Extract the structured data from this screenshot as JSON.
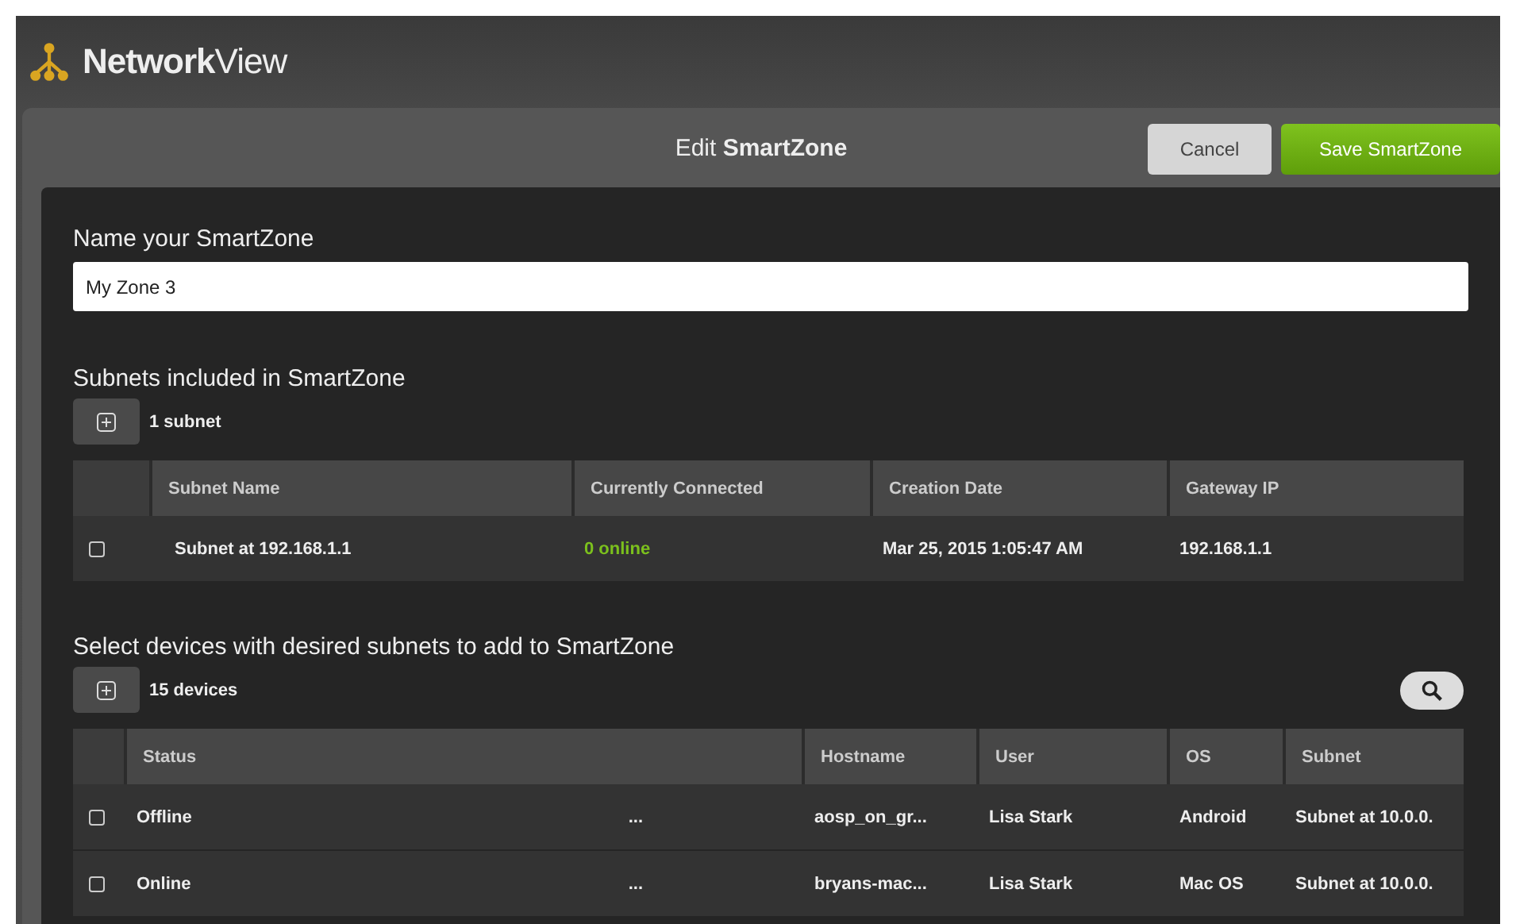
{
  "app": {
    "title": "**Network**View"
  },
  "dialog": {
    "title": "Edit **SmartZone**",
    "buttons": [
      {
        "kind": "secondary",
        "label": "Cancel"
      },
      {
        "kind": "primary",
        "label": "Save SmartZone"
      }
    ]
  },
  "name_field": {
    "label": "Name your SmartZone",
    "value": "My Zone 3"
  },
  "subnets": {
    "heading": "Subnets included in SmartZone",
    "count": "1 subnet",
    "columns": [
      "Subnet Name",
      "Currently Connected",
      "Creation Date",
      "Gateway IP"
    ],
    "rows": [
      {
        "checked": false,
        "name": "Subnet at 192.168.1.1",
        "connected": "0 online",
        "created": "Mar 25, 2015 1:05:47 AM",
        "gateway": "192.168.1.1"
      }
    ]
  },
  "devices": {
    "heading": "Select devices with desired subnets to add to SmartZone",
    "count": "15 devices",
    "columns": [
      "Status",
      "Hostname",
      "User",
      "OS",
      "Subnet"
    ],
    "rows": [
      {
        "checked": false,
        "status": "Offline",
        "column_2": "...",
        "hostname": "aosp_on_gr...",
        "user": "Lisa Stark",
        "os": "Android",
        "subnet": "Subnet at 10.0.0."
      },
      {
        "checked": false,
        "status": "Online",
        "column_2": "...",
        "hostname": "bryans-mac...",
        "user": "Lisa Stark",
        "os": "Mac OS",
        "subnet": "Subnet at 10.0.0."
      }
    ]
  }
}
